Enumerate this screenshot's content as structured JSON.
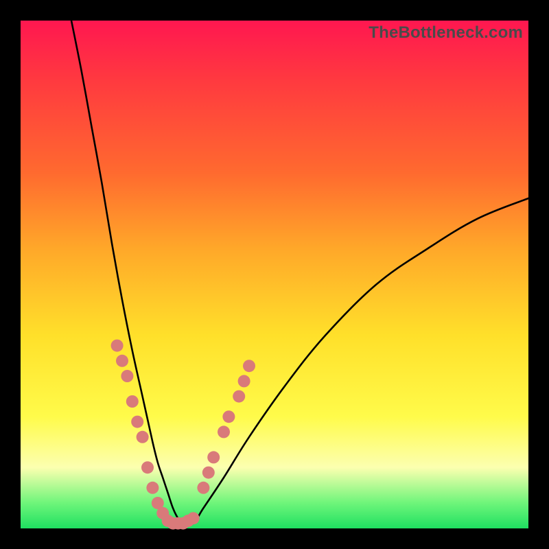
{
  "watermark": "TheBottleneck.com",
  "chart_data": {
    "type": "line",
    "title": "",
    "xlabel": "",
    "ylabel": "",
    "xlim": [
      0,
      100
    ],
    "ylim": [
      0,
      100
    ],
    "grid": false,
    "series": [
      {
        "name": "bottleneck-curve",
        "x": [
          10,
          12,
          14,
          16,
          18,
          20,
          22,
          24,
          26,
          27,
          28,
          29,
          30,
          31,
          32,
          34,
          36,
          40,
          45,
          52,
          60,
          70,
          80,
          90,
          100
        ],
        "y": [
          100,
          90,
          79,
          68,
          56,
          45,
          35,
          26,
          17,
          13,
          10,
          7,
          4,
          2,
          1,
          1,
          4,
          10,
          18,
          28,
          38,
          48,
          55,
          61,
          65
        ],
        "color": "#000000",
        "stroke_width": 2.6
      }
    ],
    "markers": [
      {
        "name": "left-cluster",
        "color": "#d97a7a",
        "radius": 9,
        "points": [
          {
            "x": 19,
            "y": 36
          },
          {
            "x": 20,
            "y": 33
          },
          {
            "x": 21,
            "y": 30
          },
          {
            "x": 22,
            "y": 25
          },
          {
            "x": 23,
            "y": 21
          },
          {
            "x": 24,
            "y": 18
          },
          {
            "x": 25,
            "y": 12
          },
          {
            "x": 26,
            "y": 8
          },
          {
            "x": 27,
            "y": 5
          },
          {
            "x": 28,
            "y": 3
          }
        ]
      },
      {
        "name": "bottom-cluster",
        "color": "#d97a7a",
        "radius": 9,
        "points": [
          {
            "x": 29,
            "y": 1.5
          },
          {
            "x": 30,
            "y": 1
          },
          {
            "x": 31,
            "y": 1
          },
          {
            "x": 32,
            "y": 1
          },
          {
            "x": 33,
            "y": 1.5
          },
          {
            "x": 34,
            "y": 2
          }
        ]
      },
      {
        "name": "right-cluster",
        "color": "#d97a7a",
        "radius": 9,
        "points": [
          {
            "x": 36,
            "y": 8
          },
          {
            "x": 37,
            "y": 11
          },
          {
            "x": 38,
            "y": 14
          },
          {
            "x": 40,
            "y": 19
          },
          {
            "x": 41,
            "y": 22
          },
          {
            "x": 43,
            "y": 26
          },
          {
            "x": 44,
            "y": 29
          },
          {
            "x": 45,
            "y": 32
          }
        ]
      }
    ]
  }
}
